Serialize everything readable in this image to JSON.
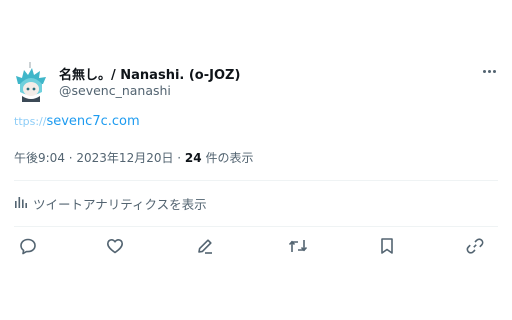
{
  "user": {
    "display_name": "名無し。/ Nanashi. (o-JOZ)",
    "handle": "@sevenc_nanashi",
    "avatar_icon": "anime-avatar-icon"
  },
  "tweet": {
    "link_scheme": "ttps://",
    "link_host": "sevenc7c.com"
  },
  "meta": {
    "timestamp": "午後9:04 · 2023年12月20日 · ",
    "views_count": "24",
    "views_label": " 件の表示"
  },
  "analytics": {
    "label": "ツイートアナリティクスを表示",
    "icon": "bar-chart-icon"
  },
  "actions": [
    {
      "icon": "reply-icon"
    },
    {
      "icon": "like-icon"
    },
    {
      "icon": "edit-icon"
    },
    {
      "icon": "retweet-icon"
    },
    {
      "icon": "bookmark-icon"
    },
    {
      "icon": "share-link-icon"
    }
  ],
  "colors": {
    "text": "#0f1419",
    "secondary": "#536471",
    "link": "#1d9bf0",
    "divider": "#eff3f4"
  }
}
